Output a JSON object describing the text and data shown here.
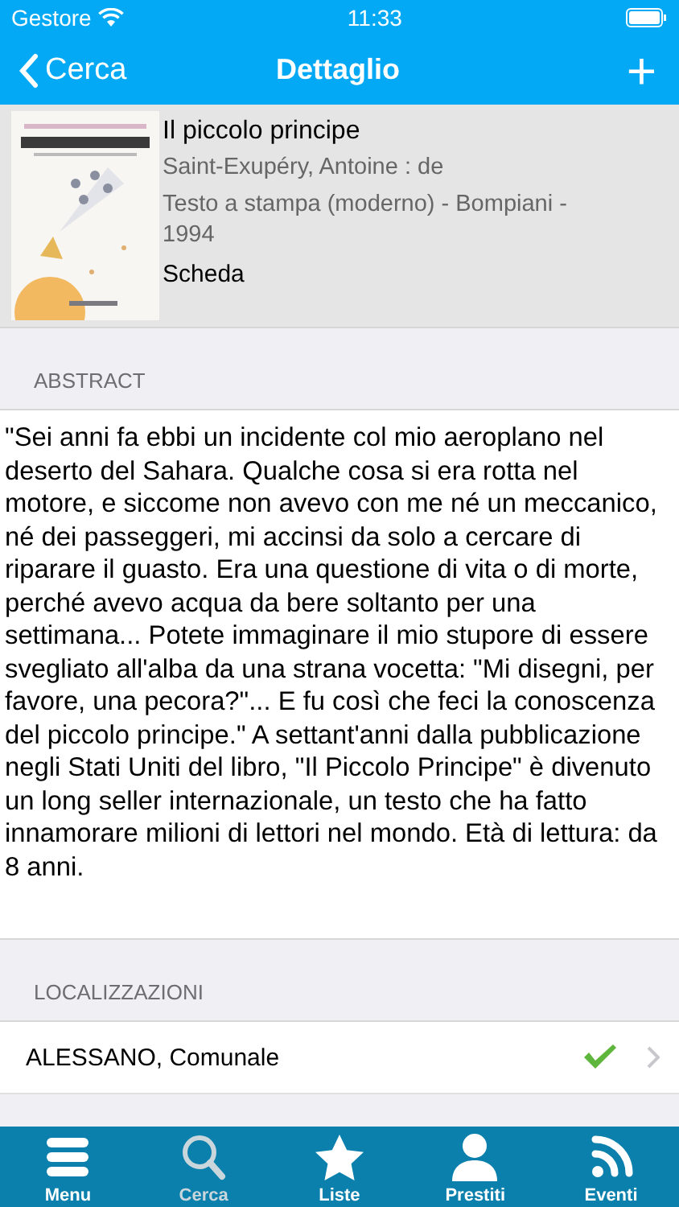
{
  "status_bar": {
    "carrier": "Gestore",
    "time": "11:33"
  },
  "nav_bar": {
    "back": "Cerca",
    "title": "Dettaglio",
    "action": "+"
  },
  "book": {
    "title": "Il piccolo principe",
    "author": "Saint-Exupéry, Antoine : de",
    "edition": "Testo a stampa (moderno) - Bompiani - 1994",
    "link": "Scheda"
  },
  "abstract": {
    "header": "ABSTRACT",
    "text": "\"Sei anni fa ebbi un incidente col mio aeroplano nel deserto del Sahara. Qualche cosa si era rotta nel motore, e siccome non avevo con me né un meccanico, né dei passeggeri, mi accinsi da solo a cercare di riparare il guasto. Era una questione di vita o di morte, perché avevo acqua da bere soltanto per una settimana... Potete immaginare il mio stupore di essere svegliato all'alba da una strana vocetta: \"Mi disegni, per favore, una pecora?\"... E fu così che feci la conoscenza del piccolo principe.\" A settant'anni dalla pubblicazione negli Stati Uniti del libro, \"Il Piccolo Principe\" è divenuto un long seller internazionale, un testo che ha fatto innamorare milioni di lettori nel mondo. Età di lettura: da 8 anni."
  },
  "locations": {
    "header": "LOCALIZZAZIONI",
    "rows": [
      {
        "name": "ALESSANO, Comunale",
        "available": true
      }
    ]
  },
  "tab_bar": [
    {
      "label": "Menu",
      "kind": "menu",
      "selected": false
    },
    {
      "label": "Cerca",
      "kind": "search",
      "selected": true
    },
    {
      "label": "Liste",
      "kind": "star",
      "selected": false
    },
    {
      "label": "Prestiti",
      "kind": "person",
      "selected": false
    },
    {
      "label": "Eventi",
      "kind": "rss",
      "selected": false
    }
  ]
}
